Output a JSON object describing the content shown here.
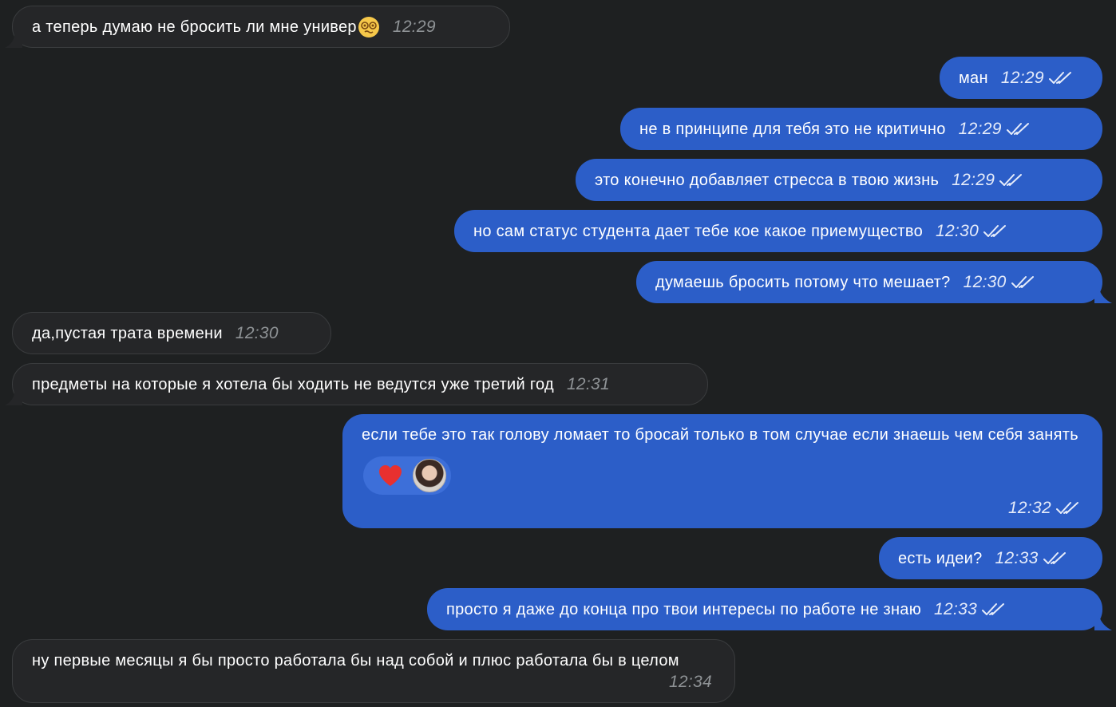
{
  "messages": [
    {
      "dir": "in",
      "text": "а теперь думаю не бросить ли мне универ",
      "emoji": "dizzy-face-emoji",
      "time": "12:29"
    },
    {
      "dir": "out",
      "text": "ман",
      "time": "12:29"
    },
    {
      "dir": "out",
      "text": "не в принципе для тебя это не критично",
      "time": "12:29"
    },
    {
      "dir": "out",
      "text": "это конечно добавляет стресса в твою жизнь",
      "time": "12:29"
    },
    {
      "dir": "out",
      "text": "но сам статус студента дает тебе кое какое приемущество",
      "time": "12:30"
    },
    {
      "dir": "out",
      "text": "думаешь бросить потому что мешает?",
      "time": "12:30"
    },
    {
      "dir": "in",
      "text": "да,пустая трата времени",
      "time": "12:30"
    },
    {
      "dir": "in",
      "text": "предметы на которые я хотела бы ходить не ведутся уже третий год",
      "time": "12:31"
    },
    {
      "dir": "out",
      "text": "если тебе это так голову ломает то бросай только в том случае если знаешь чем себя занять",
      "time": "12:32",
      "reaction": "heart-icon"
    },
    {
      "dir": "out",
      "text": "есть идеи?",
      "time": "12:33"
    },
    {
      "dir": "out",
      "text": "просто я даже до конца про твои интересы по работе не знаю",
      "time": "12:33"
    },
    {
      "dir": "in",
      "text": "ну первые месяцы я бы просто работала бы над собой и плюс работала бы в целом",
      "time": "12:34"
    }
  ],
  "colors": {
    "background": "#1e2021",
    "incoming_bubble": "#252628",
    "outgoing_bubble": "#2c5ec8"
  },
  "icons": [
    "double-check-icon",
    "heart-icon",
    "avatar",
    "dizzy-face-emoji"
  ]
}
